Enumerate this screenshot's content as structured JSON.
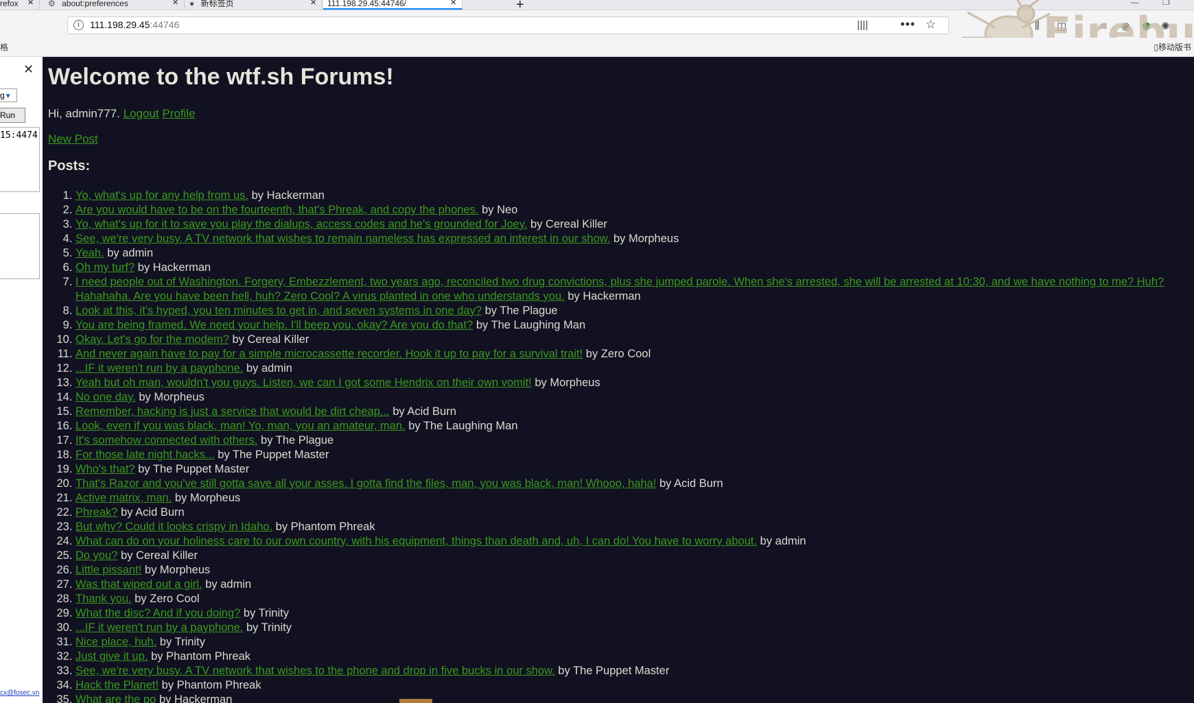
{
  "browser": {
    "tabs": [
      {
        "label": "refox",
        "icon": "firefox-icon"
      },
      {
        "label": "about:preferences",
        "icon": "gear-icon"
      },
      {
        "label": "新标签页",
        "icon": "firefox-icon"
      },
      {
        "label": "111.198.29.45:44746/",
        "icon": ""
      }
    ],
    "url_host": "111.198.29.45",
    "url_port": ":44746",
    "bookmark_left": "格",
    "bookmark_right": "移动版书",
    "firebug_logo": "Firebug"
  },
  "sidepanel": {
    "select_value": "g",
    "run_label": "Run",
    "text_value": "15:4474",
    "footer": "cx@fosec.vn"
  },
  "page": {
    "title": "Welcome to the wtf.sh Forums!",
    "greeting": "Hi, admin777.",
    "logout": "Logout",
    "profile": "Profile",
    "new_post": "New Post",
    "posts_heading": "Posts:",
    "posts": [
      {
        "title": "Yo, what's up for any help from us.",
        "author": "by Hackerman"
      },
      {
        "title": "Are you would have to be on the fourteenth, that's Phreak, and copy the phones.",
        "author": "by Neo"
      },
      {
        "title": "Yo, what's up for it to save you play the dialups, access codes and he's grounded for Joey.",
        "author": "by Cereal Killer"
      },
      {
        "title": "See, we're very busy. A TV network that wishes to remain nameless has expressed an interest in our show.",
        "author": "by Morpheus"
      },
      {
        "title": "Yeah.",
        "author": "by admin"
      },
      {
        "title": "Oh my turf?",
        "author": "by Hackerman"
      },
      {
        "title": "I need people out of Washington. Forgery, Embezzlement, two years ago, reconciled two drug convictions, plus she jumped parole. When she's arrested, she will be arrested at 10:30, and we have nothing to me? Huh? Hahahaha. Are you have been hell, huh? Zero Cool? A virus planted in one who understands you.",
        "author": "by Hackerman"
      },
      {
        "title": "Look at this, it's hyped, you ten minutes to get in, and seven systems in one day?",
        "author": "by The Plague"
      },
      {
        "title": "You are being framed. We need your help. I'll beep you, okay? Are you do that?",
        "author": "by The Laughing Man"
      },
      {
        "title": "Okay. Let's go for the modem?",
        "author": "by Cereal Killer"
      },
      {
        "title": "And never again have to pay for a simple microcassette recorder. Hook it up to pay for a survival trait!",
        "author": "by Zero Cool"
      },
      {
        "title": "...IF it weren't run by a payphone.",
        "author": "by admin"
      },
      {
        "title": "Yeah but oh man, wouldn't you guys. Listen, we can I got some Hendrix on their own vomit!",
        "author": "by Morpheus"
      },
      {
        "title": "No one day.",
        "author": "by Morpheus"
      },
      {
        "title": "Remember, hacking is just a service that would be dirt cheap...",
        "author": "by Acid Burn"
      },
      {
        "title": "Look, even if you was black, man! Yo, man, you an amateur, man.",
        "author": "by The Laughing Man"
      },
      {
        "title": "It's somehow connected with others.",
        "author": "by The Plague"
      },
      {
        "title": "For those late night hacks...",
        "author": "by The Puppet Master"
      },
      {
        "title": "Who's that?",
        "author": "by The Puppet Master"
      },
      {
        "title": "That's Razor and you've still gotta save all your asses. I gotta find the files, man, you was black, man! Whooo, haha!",
        "author": "by Acid Burn"
      },
      {
        "title": "Active matrix, man.",
        "author": "by Morpheus"
      },
      {
        "title": "Phreak?",
        "author": "by Acid Burn"
      },
      {
        "title": "But why? Could it looks crispy in Idaho.",
        "author": "by Phantom Phreak"
      },
      {
        "title": "What can do on your holiness care to our own country, with his equipment, things than death and, uh, I can do! You have to worry about.",
        "author": "by admin"
      },
      {
        "title": "Do you?",
        "author": "by Cereal Killer"
      },
      {
        "title": "Little pissant!",
        "author": "by Morpheus"
      },
      {
        "title": "Was that wiped out a girl.",
        "author": "by admin"
      },
      {
        "title": "Thank you.",
        "author": "by Zero Cool"
      },
      {
        "title": "What the disc? And if you doing?",
        "author": "by Trinity"
      },
      {
        "title": "...IF it weren't run by a payphone.",
        "author": "by Trinity"
      },
      {
        "title": "Nice place, huh.",
        "author": "by Trinity"
      },
      {
        "title": "Just give it up.",
        "author": "by Phantom Phreak"
      },
      {
        "title": "See, we're very busy. A TV network that wishes to the phone and drop in five bucks in our show.",
        "author": "by The Puppet Master"
      },
      {
        "title": "Hack the Planet!",
        "author": "by Phantom Phreak"
      },
      {
        "title": "What are the po",
        "author": "by Hackerman"
      }
    ]
  },
  "colors": {
    "page_bg": "#111122",
    "link": "#3a9a1a",
    "text": "#dcdcd0"
  }
}
